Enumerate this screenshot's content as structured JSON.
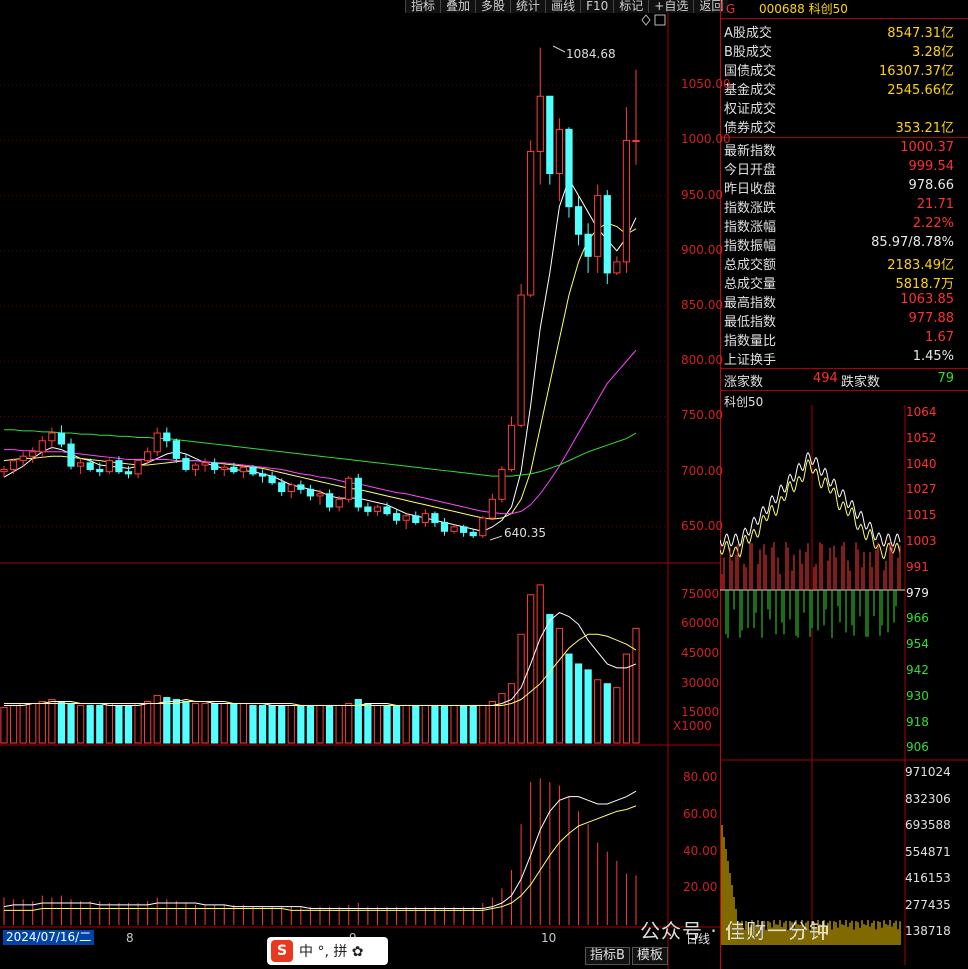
{
  "toolbar": [
    "指标",
    "叠加",
    "多股",
    "统计",
    "画线",
    "F10",
    "标记",
    "+自选",
    "返回"
  ],
  "toolbar_icons": [
    "diamond-icon",
    "window-icon"
  ],
  "header": {
    "code": "000688",
    "name": "科创50",
    "marker": "G"
  },
  "market": [
    {
      "label": "A股成交",
      "value": "8547.31亿",
      "color": "#ffd400"
    },
    {
      "label": "B股成交",
      "value": "3.28亿",
      "color": "#ffd400"
    },
    {
      "label": "国债成交",
      "value": "16307.37亿",
      "color": "#ffd400"
    },
    {
      "label": "基金成交",
      "value": "2545.66亿",
      "color": "#ffd400"
    },
    {
      "label": "权证成交",
      "value": "",
      "color": "#ffd400"
    },
    {
      "label": "债券成交",
      "value": "353.21亿",
      "color": "#ffd400"
    }
  ],
  "index_info": [
    {
      "label": "最新指数",
      "value": "1000.37",
      "color": "#ff3030"
    },
    {
      "label": "今日开盘",
      "value": "999.54",
      "color": "#ff3030"
    },
    {
      "label": "昨日收盘",
      "value": "978.66",
      "color": "#e8e8e8"
    },
    {
      "label": "指数涨跌",
      "value": "21.71",
      "color": "#ff3030"
    },
    {
      "label": "指数涨幅",
      "value": "2.22%",
      "color": "#ff3030"
    },
    {
      "label": "指数振幅",
      "value": "85.97/8.78%",
      "color": "#e8e8e8"
    },
    {
      "label": "总成交额",
      "value": "2183.49亿",
      "color": "#ffd400"
    },
    {
      "label": "总成交量",
      "value": "5818.7万",
      "color": "#ffd400"
    },
    {
      "label": "最高指数",
      "value": "1063.85",
      "color": "#ff3030"
    },
    {
      "label": "最低指数",
      "value": "977.88",
      "color": "#ff3030"
    },
    {
      "label": "指数量比",
      "value": "1.67",
      "color": "#ff3030"
    },
    {
      "label": "上证换手",
      "value": "1.45%",
      "color": "#e8e8e8"
    }
  ],
  "breadth": {
    "up_label": "涨家数",
    "up": "494",
    "down_label": "跌家数",
    "down": "79"
  },
  "minute_title": "科创50",
  "minute_price_labels": [
    "1064",
    "1052",
    "1040",
    "1027",
    "1015",
    "1003",
    "991",
    "979",
    "966",
    "954",
    "942",
    "930",
    "918",
    "906"
  ],
  "minute_vol_labels": [
    "971024",
    "832306",
    "693588",
    "554871",
    "416153",
    "277435",
    "138718"
  ],
  "price_axis": [
    "1050.00",
    "1000.00",
    "950.00",
    "900.00",
    "850.00",
    "800.00",
    "750.00",
    "700.00",
    "650.00"
  ],
  "vol_axis": [
    "75000",
    "60000",
    "45000",
    "30000",
    "15000"
  ],
  "vol_unit": "X1000",
  "ind_axis": [
    "80.00",
    "60.00",
    "40.00",
    "20.00"
  ],
  "annotations": {
    "high": "1084.68",
    "low": "640.35"
  },
  "date_label": "2024/07/16/二",
  "months": [
    "8",
    "9",
    "10"
  ],
  "bottom_tabs": [
    "指标B",
    "模板"
  ],
  "bottom_extra": "日线",
  "ime": {
    "logo": "S",
    "text": "中 °, 拼 ✿"
  },
  "watermark": "公众号 · 佳财一分钟",
  "chart_data": {
    "type": "candlestick",
    "ylim": [
      620,
      1100
    ],
    "candles": [
      [
        700,
        705,
        695,
        702
      ],
      [
        702,
        712,
        698,
        710
      ],
      [
        710,
        718,
        705,
        714
      ],
      [
        714,
        722,
        708,
        718
      ],
      [
        718,
        732,
        712,
        728
      ],
      [
        728,
        740,
        720,
        735
      ],
      [
        735,
        742,
        722,
        725
      ],
      [
        725,
        730,
        702,
        705
      ],
      [
        705,
        712,
        698,
        708
      ],
      [
        708,
        712,
        700,
        702
      ],
      [
        702,
        708,
        696,
        700
      ],
      [
        700,
        712,
        698,
        710
      ],
      [
        710,
        714,
        698,
        700
      ],
      [
        700,
        705,
        694,
        698
      ],
      [
        698,
        712,
        694,
        710
      ],
      [
        710,
        722,
        706,
        718
      ],
      [
        718,
        740,
        714,
        735
      ],
      [
        735,
        740,
        722,
        728
      ],
      [
        728,
        730,
        708,
        712
      ],
      [
        712,
        716,
        700,
        702
      ],
      [
        702,
        708,
        696,
        706
      ],
      [
        706,
        712,
        700,
        708
      ],
      [
        708,
        712,
        698,
        702
      ],
      [
        702,
        706,
        696,
        704
      ],
      [
        704,
        708,
        698,
        700
      ],
      [
        700,
        706,
        694,
        704
      ],
      [
        704,
        706,
        696,
        698
      ],
      [
        698,
        702,
        690,
        696
      ],
      [
        696,
        700,
        688,
        690
      ],
      [
        690,
        694,
        678,
        682
      ],
      [
        682,
        690,
        676,
        688
      ],
      [
        688,
        692,
        680,
        684
      ],
      [
        684,
        688,
        674,
        678
      ],
      [
        678,
        684,
        670,
        680
      ],
      [
        680,
        684,
        664,
        668
      ],
      [
        668,
        678,
        664,
        675
      ],
      [
        675,
        696,
        672,
        694
      ],
      [
        694,
        698,
        664,
        668
      ],
      [
        668,
        672,
        660,
        664
      ],
      [
        664,
        670,
        660,
        668
      ],
      [
        668,
        672,
        660,
        662
      ],
      [
        662,
        666,
        652,
        656
      ],
      [
        656,
        662,
        648,
        660
      ],
      [
        660,
        664,
        652,
        654
      ],
      [
        654,
        666,
        650,
        662
      ],
      [
        662,
        664,
        650,
        654
      ],
      [
        654,
        658,
        642,
        646
      ],
      [
        646,
        652,
        644,
        650
      ],
      [
        650,
        652,
        641,
        645
      ],
      [
        645,
        648,
        640,
        642
      ],
      [
        642,
        660,
        640,
        658
      ],
      [
        658,
        680,
        656,
        675
      ],
      [
        675,
        705,
        672,
        702
      ],
      [
        702,
        750,
        700,
        742
      ],
      [
        742,
        870,
        740,
        860
      ],
      [
        860,
        1000,
        858,
        990
      ],
      [
        990,
        1084,
        960,
        1040
      ],
      [
        1040,
        1040,
        960,
        970
      ],
      [
        970,
        1020,
        945,
        1010
      ],
      [
        1010,
        1012,
        930,
        940
      ],
      [
        940,
        950,
        905,
        915
      ],
      [
        915,
        925,
        880,
        895
      ],
      [
        895,
        960,
        880,
        950
      ],
      [
        950,
        955,
        870,
        880
      ],
      [
        880,
        895,
        878,
        890
      ],
      [
        890,
        1030,
        880,
        1000
      ],
      [
        999,
        1064,
        978,
        1000
      ]
    ],
    "ma": [
      {
        "name": "MA5",
        "color": "#ffffff",
        "values": [
          695,
          700,
          705,
          712,
          718,
          722,
          720,
          716,
          712,
          710,
          706,
          705,
          704,
          703,
          705,
          708,
          712,
          716,
          718,
          716,
          712,
          708,
          705,
          703,
          702,
          701,
          700,
          698,
          696,
          692,
          688,
          686,
          684,
          682,
          678,
          676,
          676,
          676,
          674,
          672,
          670,
          666,
          662,
          660,
          658,
          656,
          654,
          652,
          650,
          648,
          646,
          650,
          656,
          668,
          700,
          760,
          830,
          880,
          940,
          965,
          950,
          935,
          920,
          910,
          900,
          912,
          930
        ]
      },
      {
        "name": "MA10",
        "color": "#ffff66",
        "values": [
          710,
          711,
          712,
          712,
          713,
          714,
          714,
          713,
          712,
          711,
          710,
          709,
          708,
          707,
          706,
          706,
          707,
          708,
          709,
          710,
          710,
          709,
          708,
          707,
          706,
          705,
          704,
          703,
          701,
          699,
          697,
          695,
          693,
          691,
          689,
          687,
          685,
          684,
          682,
          680,
          678,
          676,
          674,
          672,
          670,
          668,
          666,
          664,
          662,
          660,
          658,
          657,
          658,
          662,
          675,
          700,
          740,
          780,
          820,
          860,
          890,
          910,
          920,
          925,
          922,
          915,
          920
        ]
      },
      {
        "name": "MA20",
        "color": "#ff44ff",
        "values": [
          720,
          720,
          719,
          719,
          718,
          718,
          718,
          717,
          716,
          715,
          714,
          713,
          712,
          711,
          711,
          711,
          711,
          711,
          710,
          710,
          710,
          709,
          708,
          708,
          707,
          706,
          705,
          704,
          703,
          702,
          700,
          698,
          697,
          695,
          694,
          692,
          690,
          689,
          687,
          685,
          683,
          681,
          680,
          678,
          676,
          674,
          672,
          670,
          668,
          666,
          664,
          663,
          662,
          662,
          664,
          670,
          680,
          692,
          705,
          720,
          735,
          750,
          765,
          780,
          790,
          800,
          810
        ]
      },
      {
        "name": "MA60",
        "color": "#33dd33",
        "values": [
          738,
          738,
          737,
          737,
          736,
          736,
          735,
          735,
          734,
          734,
          733,
          733,
          732,
          732,
          731,
          731,
          730,
          730,
          729,
          728,
          727,
          726,
          725,
          724,
          723,
          722,
          721,
          720,
          719,
          718,
          717,
          716,
          715,
          714,
          713,
          712,
          711,
          710,
          709,
          708,
          707,
          706,
          705,
          704,
          703,
          702,
          701,
          700,
          699,
          698,
          697,
          696,
          696,
          696,
          697,
          698,
          700,
          703,
          706,
          710,
          714,
          718,
          721,
          724,
          727,
          730,
          735
        ]
      }
    ],
    "volume": [
      18,
      19,
      20,
      20,
      21,
      22,
      21,
      20,
      19,
      19,
      19,
      20,
      19,
      19,
      20,
      21,
      24,
      23,
      22,
      21,
      20,
      20,
      20,
      20,
      20,
      20,
      19,
      19,
      19,
      19,
      19,
      19,
      19,
      19,
      19,
      19,
      20,
      22,
      20,
      19,
      19,
      19,
      19,
      19,
      19,
      19,
      19,
      19,
      19,
      19,
      19,
      21,
      25,
      30,
      55,
      75,
      80,
      65,
      58,
      45,
      40,
      37,
      32,
      30,
      28,
      45,
      58
    ],
    "volume_ma": [
      {
        "name": "VMA5",
        "color": "#ffffff",
        "values": [
          19,
          19,
          19,
          20,
          20,
          21,
          21,
          21,
          20,
          20,
          20,
          19,
          19,
          19,
          19,
          20,
          20,
          21,
          21,
          22,
          21,
          21,
          20,
          20,
          20,
          20,
          20,
          20,
          19,
          19,
          19,
          19,
          19,
          19,
          19,
          19,
          19,
          19,
          20,
          20,
          20,
          19,
          19,
          19,
          19,
          19,
          19,
          19,
          19,
          19,
          19,
          19,
          20,
          22,
          28,
          40,
          53,
          62,
          66,
          64,
          60,
          52,
          46,
          40,
          38,
          38,
          40
        ]
      },
      {
        "name": "VMA10",
        "color": "#ffff66",
        "values": [
          20,
          20,
          20,
          20,
          20,
          20,
          20,
          20,
          20,
          20,
          20,
          20,
          20,
          20,
          20,
          20,
          20,
          20,
          20,
          21,
          21,
          21,
          21,
          21,
          20,
          20,
          20,
          20,
          20,
          20,
          20,
          19,
          19,
          19,
          19,
          19,
          19,
          19,
          19,
          19,
          19,
          19,
          19,
          19,
          19,
          19,
          19,
          19,
          19,
          19,
          19,
          19,
          19,
          20,
          22,
          26,
          30,
          36,
          42,
          48,
          52,
          55,
          55,
          54,
          52,
          50,
          47
        ]
      }
    ],
    "indicator": {
      "bars": [
        15,
        14,
        14,
        13,
        16,
        15,
        16,
        14,
        13,
        13,
        13,
        12,
        12,
        12,
        12,
        13,
        15,
        14,
        13,
        12,
        11,
        11,
        11,
        11,
        11,
        11,
        10,
        10,
        10,
        10,
        10,
        10,
        10,
        10,
        10,
        10,
        11,
        12,
        10,
        10,
        10,
        10,
        10,
        10,
        10,
        10,
        10,
        10,
        10,
        10,
        12,
        15,
        20,
        30,
        55,
        78,
        80,
        78,
        76,
        70,
        62,
        55,
        45,
        40,
        35,
        28,
        27
      ],
      "lines": [
        {
          "name": "L1",
          "color": "#ffffff",
          "values": [
            10,
            11,
            11,
            11,
            12,
            12,
            12,
            12,
            12,
            12,
            11,
            11,
            11,
            11,
            11,
            11,
            12,
            12,
            12,
            12,
            12,
            11,
            11,
            11,
            10,
            10,
            10,
            10,
            10,
            10,
            10,
            10,
            9,
            9,
            9,
            9,
            9,
            9,
            9,
            9,
            9,
            9,
            9,
            9,
            9,
            9,
            9,
            9,
            9,
            9,
            9,
            10,
            12,
            16,
            25,
            38,
            52,
            62,
            68,
            70,
            70,
            68,
            66,
            66,
            68,
            70,
            73
          ]
        },
        {
          "name": "L2",
          "color": "#ffff66",
          "values": [
            8,
            8,
            8,
            8,
            9,
            9,
            9,
            9,
            9,
            9,
            9,
            9,
            9,
            9,
            9,
            9,
            9,
            9,
            9,
            9,
            9,
            9,
            9,
            9,
            9,
            9,
            9,
            9,
            9,
            9,
            8,
            8,
            8,
            8,
            8,
            8,
            8,
            8,
            8,
            8,
            8,
            8,
            8,
            8,
            8,
            8,
            8,
            8,
            8,
            8,
            8,
            9,
            10,
            12,
            16,
            22,
            30,
            38,
            45,
            50,
            54,
            56,
            58,
            60,
            62,
            63,
            65
          ]
        }
      ]
    }
  }
}
